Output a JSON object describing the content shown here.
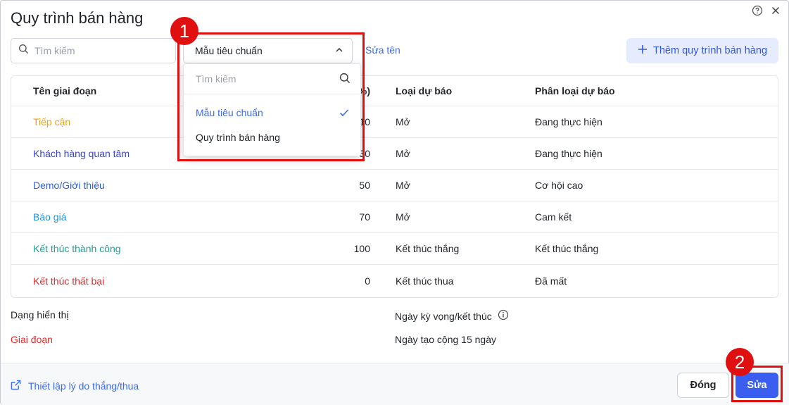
{
  "dialog": {
    "title": "Quy trình bán hàng"
  },
  "toolbar": {
    "search_placeholder": "Tìm kiếm",
    "selected_template": "Mẫu tiêu chuẩn",
    "rename_label": "Sửa tên",
    "add_label": "Thêm quy trình bán hàng"
  },
  "table": {
    "headers": {
      "name": "Tên giai đoạn",
      "pct": "(%)",
      "type": "Loại dự báo",
      "cls": "Phân loại dự báo"
    },
    "rows": [
      {
        "name": "Tiếp cận",
        "pct": "10",
        "type": "Mở",
        "cls": "Đang thực hiện",
        "color": "#e8a317"
      },
      {
        "name": "Khách hàng quan tâm",
        "pct": "30",
        "type": "Mở",
        "cls": "Đang thực hiện",
        "color": "#3a45c8"
      },
      {
        "name": "Demo/Giới thiệu",
        "pct": "50",
        "type": "Mở",
        "cls": "Cơ hội cao",
        "color": "#2f5fd0"
      },
      {
        "name": "Báo giá",
        "pct": "70",
        "type": "Mở",
        "cls": "Cam kết",
        "color": "#1f8fd8"
      },
      {
        "name": "Kết thúc thành công",
        "pct": "100",
        "type": "Kết thúc thắng",
        "cls": "Kết thúc thắng",
        "color": "#1aa39a"
      },
      {
        "name": "Kết thúc thất bại",
        "pct": "0",
        "type": "Kết thúc thua",
        "cls": "Đã mất",
        "color": "#e02b2b"
      }
    ]
  },
  "dropdown": {
    "search_placeholder": "Tìm kiếm",
    "options": [
      "Mẫu tiêu chuẩn",
      "Quy trình bán hàng"
    ]
  },
  "settings": {
    "display_label": "Dạng hiển thị",
    "display_value": "Giai đoạn",
    "expected_label": "Ngày kỳ vọng/kết thúc",
    "expected_value": "Ngày tạo cộng 15 ngày"
  },
  "footer": {
    "reason_link": "Thiết lập lý do thắng/thua",
    "close_label": "Đóng",
    "edit_label": "Sửa"
  },
  "annotations": {
    "step1": "1",
    "step2": "2"
  },
  "colors": {
    "accent": "#3a5ff0",
    "highlight": "#e01010",
    "display_value": "#e02b2b"
  }
}
